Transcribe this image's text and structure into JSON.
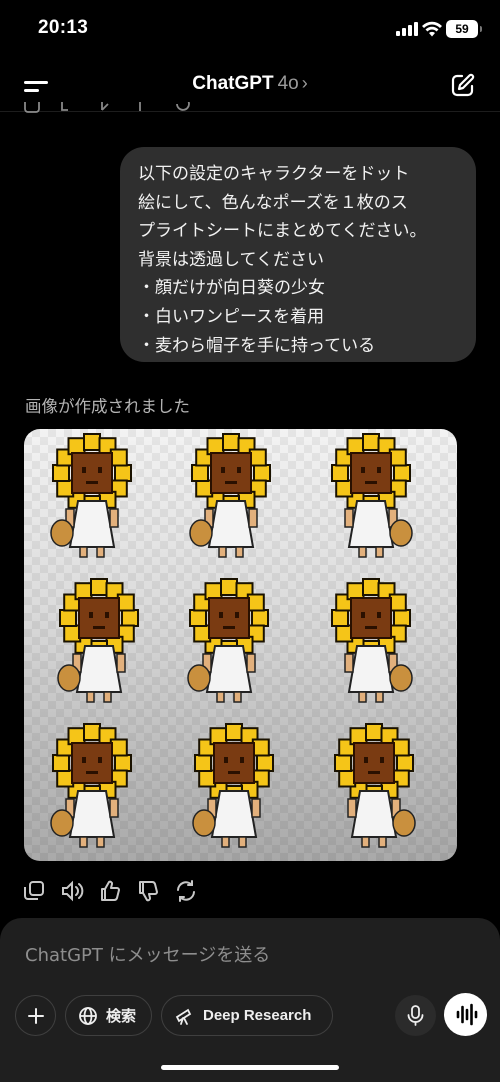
{
  "status_bar": {
    "time": "20:13",
    "battery": "59"
  },
  "header": {
    "title": "ChatGPT",
    "model": "4o",
    "chevron": "›"
  },
  "conversation": {
    "user_message_lines": [
      "以下の設定のキャラクターをドット",
      "絵にして、色んなポーズを１枚のス",
      "プライトシートにまとめてください。",
      "背景は透過してください",
      "・顔だけが向日葵の少女",
      "・白いワンピースを着用",
      "・麦わら帽子を手に持っている"
    ],
    "image_status": "画像が作成されました"
  },
  "composer": {
    "placeholder": "ChatGPT にメッセージを送る",
    "search_label": "検索",
    "research_label": "Deep Research"
  },
  "colors": {
    "background": "#000000",
    "bubble": "#2f2f2f",
    "composer": "#1f1f1f",
    "petal": "#f5c518",
    "face": "#7a3b12"
  },
  "icons": [
    "menu-icon",
    "edit-icon",
    "copy-icon",
    "speaker-icon",
    "thumbs-up-icon",
    "thumbs-down-icon",
    "regenerate-icon",
    "plus-icon",
    "globe-icon",
    "telescope-icon",
    "mic-icon",
    "voice-wave-icon"
  ]
}
